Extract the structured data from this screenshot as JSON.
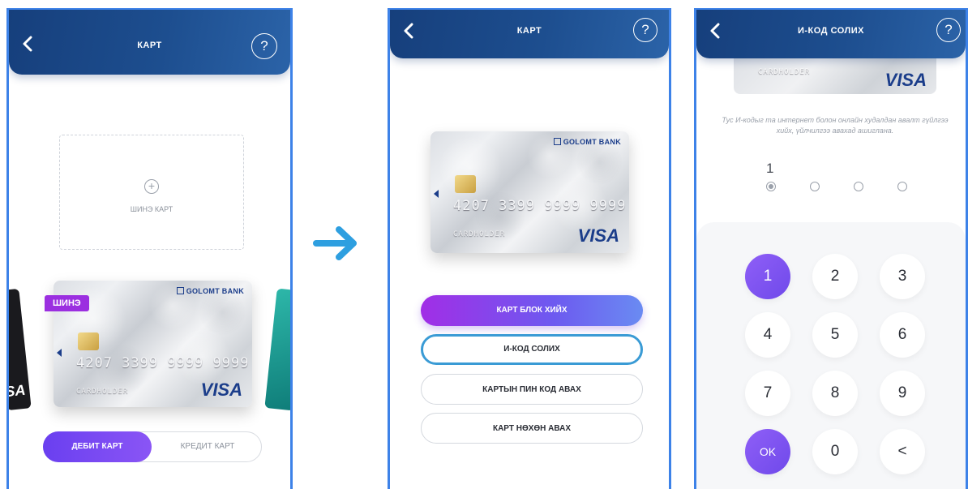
{
  "screen1": {
    "title": "КАРТ",
    "help": "?",
    "new_card_label": "ШИНЭ КАРТ",
    "new_tag": "ШИНЭ",
    "side_left_text": "SA",
    "card": {
      "bank": "GOLOMT BANK",
      "number": "4207 3399 9999 9999",
      "holder": "CARDHOLDER",
      "brand": "VISA"
    },
    "segment": {
      "debit": "ДЕБИТ КАРТ",
      "credit": "КРЕДИТ КАРТ"
    }
  },
  "screen2": {
    "title": "КАРТ",
    "help": "?",
    "card": {
      "bank": "GOLOMT BANK",
      "number": "4207 3399 9999 9999",
      "holder": "CARDHOLDER",
      "brand": "VISA"
    },
    "buttons": [
      "КАРТ БЛОК ХИЙХ",
      "И-КОД СОЛИХ",
      "КАРТЫН ПИН КОД АВАХ",
      "КАРТ НӨХӨН АВАХ"
    ]
  },
  "screen3": {
    "title": "И-КОД СОЛИХ",
    "help": "?",
    "card": {
      "holder": "CARDHOLDER",
      "brand": "VISA"
    },
    "note": "Тус И-кодыг та интернет болон онлайн худалдан авалт гүйлгээ хийх, үйлчилгээ авахад ашиглана.",
    "entered_digit": "1",
    "keys": [
      "1",
      "2",
      "3",
      "4",
      "5",
      "6",
      "7",
      "8",
      "9",
      "OK",
      "0",
      "<"
    ]
  },
  "colors": {
    "header": "#1d4e8f",
    "accent_purple": "#7b4cf0",
    "selected_outline": "#3a9bd5",
    "arrow": "#2e9fe0"
  }
}
